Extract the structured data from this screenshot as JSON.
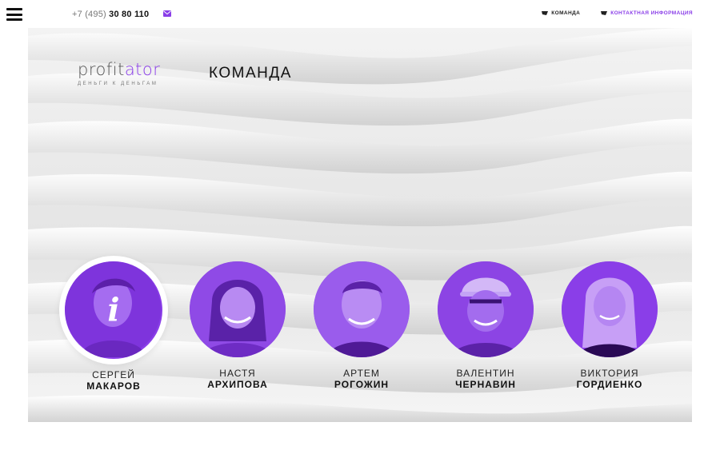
{
  "header": {
    "phone_prefix": "+7 (495)",
    "phone_number": "30 80 110",
    "nav": [
      {
        "label": "КОМАНДА"
      },
      {
        "label": "КОНТАКТНАЯ ИНФОРМАЦИЯ"
      }
    ]
  },
  "logo": {
    "word_part1": "profit",
    "word_part2": "ator",
    "tagline": "ДЕНЬГИ К ДЕНЬГАМ"
  },
  "page_title": "КОМАНДА",
  "team": [
    {
      "first": "СЕРГЕЙ",
      "last": "МАКАРОВ",
      "active": true,
      "badge": "i"
    },
    {
      "first": "НАСТЯ",
      "last": "АРХИПОВА"
    },
    {
      "first": "АРТЕМ",
      "last": "РОГОЖИН"
    },
    {
      "first": "ВАЛЕНТИН",
      "last": "ЧЕРНАВИН"
    },
    {
      "first": "ВИКТОРИЯ",
      "last": "ГОРДИЕНКО"
    }
  ],
  "colors": {
    "accent": "#8a3ee8",
    "text": "#111111",
    "background": "#ffffff"
  },
  "icons": {
    "menu": "hamburger-icon",
    "mail": "envelope-icon",
    "nav": "arrow-chip-icon",
    "badge": "info-icon"
  }
}
